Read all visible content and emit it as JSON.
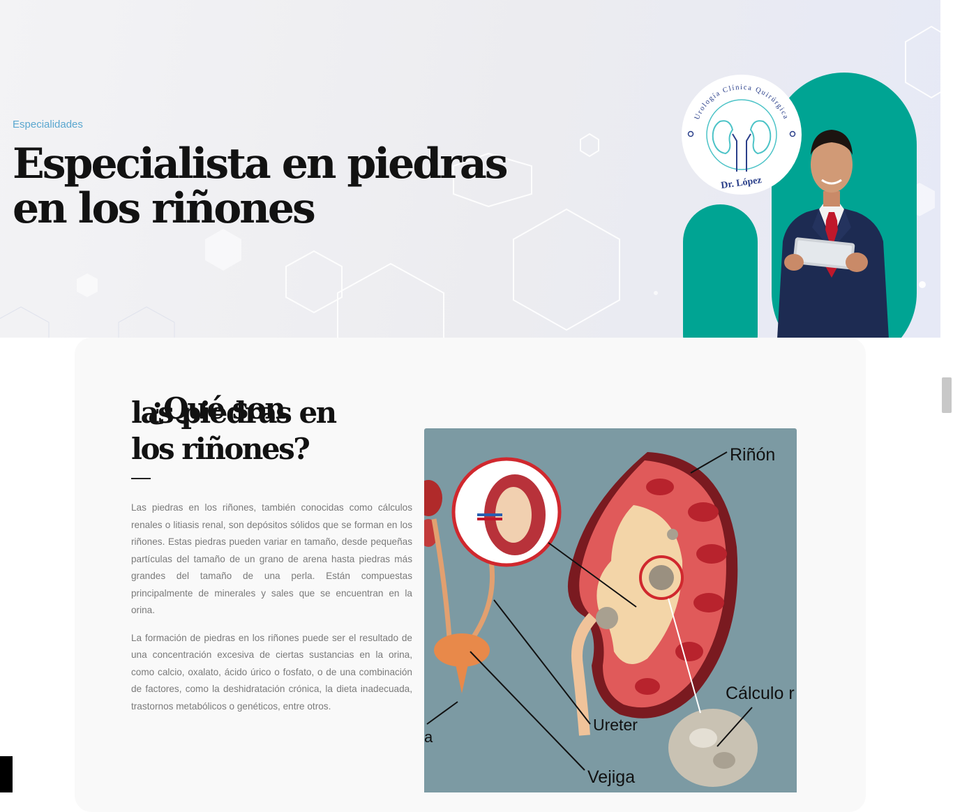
{
  "hero": {
    "eyebrow": "Especialidades",
    "title": "Especialista en piedras en los riñones",
    "logo": {
      "arc_text": "Urología Clínica Quirúrgica",
      "name": "Dr. López"
    },
    "accent_color": "#00a493"
  },
  "section": {
    "title_overlap": "¿Qué son",
    "title": "las piedras en los riñones?",
    "paragraphs": [
      "Las piedras en los riñones, también conocidas como cálculos renales o litiasis renal, son depósitos sólidos que se forman en los riñones. Estas piedras pueden variar en tamaño, desde pequeñas partículas del tamaño de un grano de arena hasta piedras más grandes del tamaño de una perla. Están compuestas principalmente de minerales y sales que se encuentran en la orina.",
      "La formación de piedras en los riñones puede ser el resultado de una concentración excesiva de ciertas sustancias en la orina, como calcio, oxalato, ácido úrico o fosfato, o de una combinación de factores, como la deshidratación crónica, la dieta inadecuada, trastornos metabólicos o genéticos, entre otros."
    ],
    "illustration_labels": {
      "kidney": "Riñón",
      "stone": "Cálculo r",
      "ureter": "Ureter",
      "bladder": "Vejiga",
      "cut_left": "a"
    }
  }
}
